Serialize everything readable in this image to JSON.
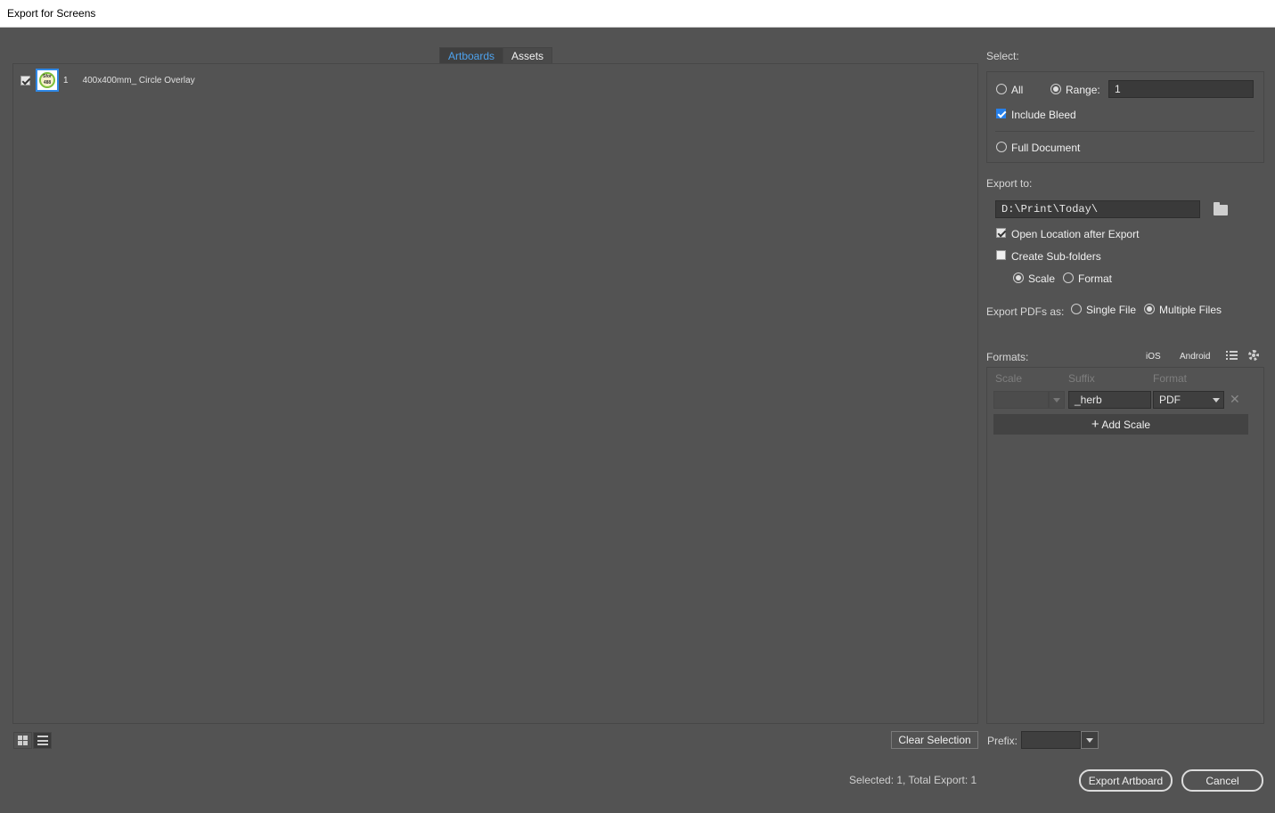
{
  "window": {
    "title": "Export for Screens"
  },
  "tabs": [
    {
      "label": "Artboards",
      "active": true
    },
    {
      "label": "Assets",
      "active": false
    }
  ],
  "artboards": [
    {
      "checked": true,
      "number": "1",
      "name": "400x400mm_ Circle Overlay",
      "thumb_text": "Sfor 488"
    }
  ],
  "left_footer": {
    "clear_selection_label": "Clear Selection",
    "status": "Selected: 1, Total Export: 1"
  },
  "select": {
    "heading": "Select:",
    "all_label": "All",
    "range_label": "Range:",
    "range_value": "1",
    "include_bleed_label": "Include Bleed",
    "full_document_label": "Full Document"
  },
  "export_to": {
    "heading": "Export to:",
    "path": "D:\\Print\\Today\\",
    "open_location_label": "Open Location after Export",
    "create_subfolders_label": "Create Sub-folders",
    "scale_label": "Scale",
    "format_label": "Format",
    "pdfs_as_label": "Export PDFs as:",
    "single_file_label": "Single File",
    "multiple_files_label": "Multiple Files"
  },
  "formats": {
    "heading": "Formats:",
    "ios_label": "iOS",
    "android_label": "Android",
    "col_scale": "Scale",
    "col_suffix": "Suffix",
    "col_format": "Format",
    "row": {
      "scale": "",
      "suffix": "_herb",
      "format": "PDF"
    },
    "add_scale_label": "Add Scale"
  },
  "prefix": {
    "label": "Prefix:",
    "value": ""
  },
  "actions": {
    "export_label": "Export Artboard",
    "cancel_label": "Cancel"
  }
}
